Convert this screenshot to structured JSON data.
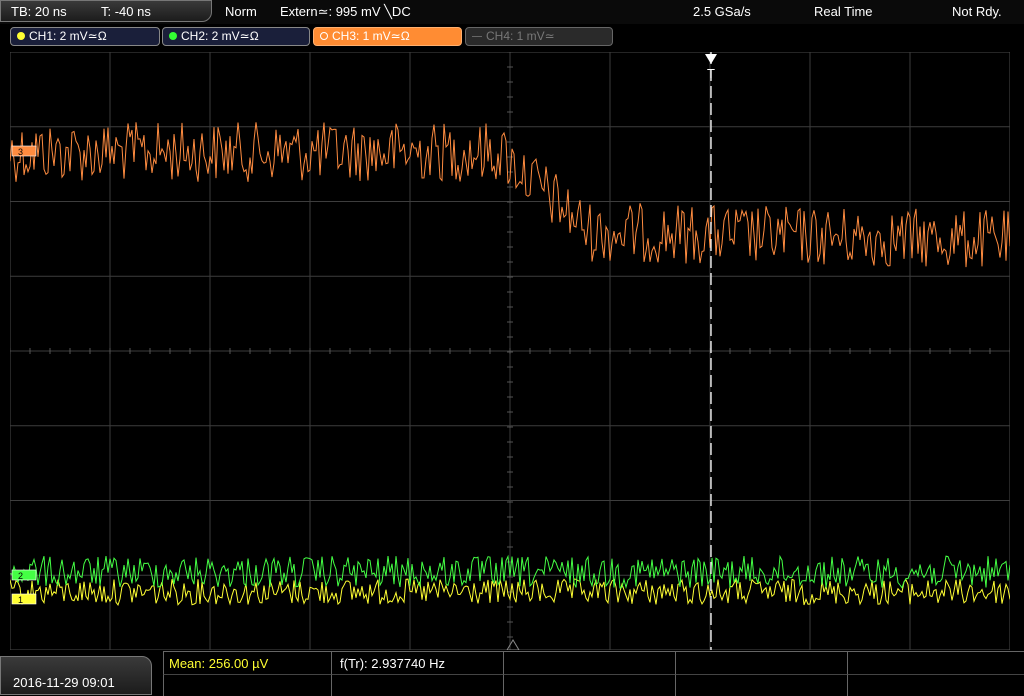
{
  "topbar": {
    "timebase": "TB: 20 ns",
    "trigger_time": "T: -40 ns",
    "mode": "Norm",
    "trigger_source": "Extern≃: 995 mV ╲DC",
    "sample_rate": "2.5 GSa/s",
    "acq_mode": "Real Time",
    "status": "Not Rdy."
  },
  "channels": [
    {
      "label": "CH1: 2 mV≃Ω",
      "color": "#ffff33"
    },
    {
      "label": "CH2: 2 mV≃Ω",
      "color": "#33ff33"
    },
    {
      "label": "CH3: 1 mV≃Ω",
      "color": "#ff8c33"
    },
    {
      "label": "CH4: 1 mV≃",
      "color": "#777777"
    }
  ],
  "markers": {
    "ch3": "3",
    "ch1": "1",
    "ch2": "2",
    "trigger": "T"
  },
  "footer": {
    "datetime": "2016-11-29 09:01",
    "mean": "Mean: 256.00 µV",
    "freq": "f(Tr): 2.937740 Hz"
  },
  "colors": {
    "grid": "#3d3d3d",
    "ch1": "#ffff33",
    "ch2": "#44ff44",
    "ch3": "#ff8c40",
    "trigger_line": "#ffffff"
  }
}
